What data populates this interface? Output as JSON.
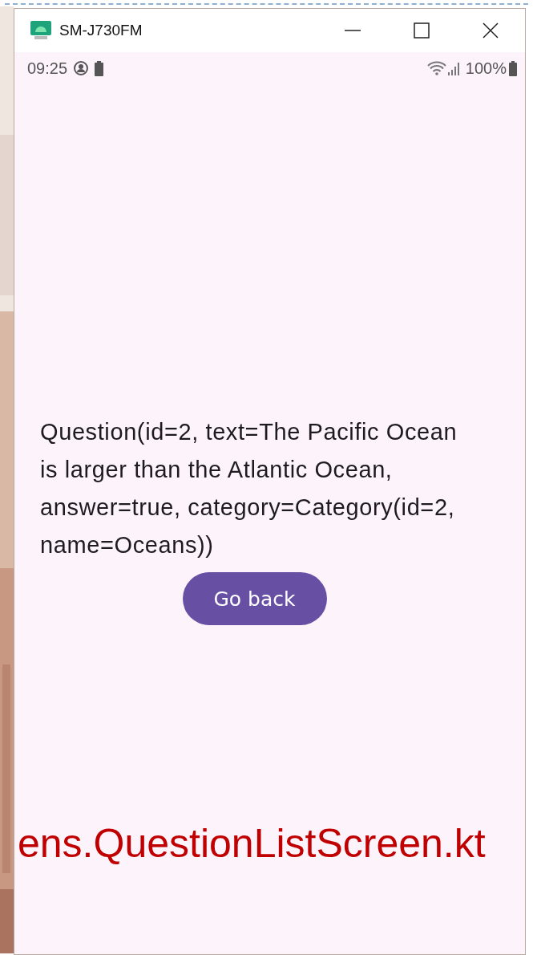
{
  "window": {
    "title": "SM-J730FM"
  },
  "status_bar": {
    "time": "09:25",
    "battery": "100%"
  },
  "screen": {
    "question": "Question(id=2, text=The Pacific Ocean is larger than the Atlantic Ocean, answer=true, category=Category(id=2, name=Oceans))",
    "button": "Go back"
  },
  "overlay_caption": "ens.QuestionListScreen.kt"
}
